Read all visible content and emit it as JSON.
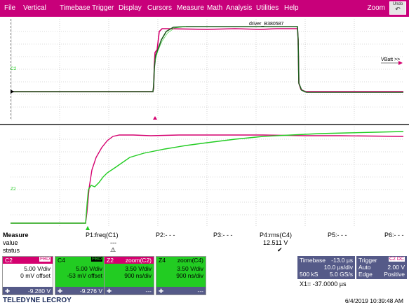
{
  "menu": {
    "items": [
      "File",
      "Vertical",
      "Timebase",
      "Trigger",
      "Display",
      "Cursors",
      "Measure",
      "Math",
      "Analysis",
      "Utilities",
      "Help"
    ],
    "zoom_label": "Zoom",
    "undo_label": "Undo"
  },
  "upper_grid": {
    "channel_label": "C2",
    "annotation": "driver_B380587",
    "vbatt_label": "VBatt >>"
  },
  "lower_grid": {
    "channel_label": "Z2"
  },
  "measure": {
    "header": "Measure",
    "row_labels": [
      "value",
      "status"
    ],
    "columns": [
      {
        "name": "P1:freq(C1)",
        "value": "---",
        "status": "warn"
      },
      {
        "name": "P2:- - -",
        "value": "",
        "status": ""
      },
      {
        "name": "P3:- - -",
        "value": "",
        "status": ""
      },
      {
        "name": "P4:rms(C4)",
        "value": "12.511 V",
        "status": "ok"
      },
      {
        "name": "P5:- - -",
        "value": "",
        "status": ""
      },
      {
        "name": "P6:- - -",
        "value": "",
        "status": ""
      }
    ]
  },
  "channels": [
    {
      "id": "C2",
      "tag": "FBD",
      "line1": "5.00 V/div",
      "line2": "0 mV offset",
      "footer": "-9.280 V",
      "color": "#d4006f"
    },
    {
      "id": "C4",
      "tag": "FBD",
      "line1": "5.00 V/div",
      "line2": "-53 mV offset",
      "footer": "-9.276 V",
      "color": "#22cc22"
    },
    {
      "id": "Z2",
      "tag": "zoom(C2)",
      "line1": "3.50 V/div",
      "line2": "900 ns/div",
      "footer": "---",
      "color": "#d4006f"
    },
    {
      "id": "Z4",
      "tag": "zoom(C4)",
      "line1": "3.50 V/div",
      "line2": "900 ns/div",
      "footer": "---",
      "color": "#22cc22"
    }
  ],
  "timebase": {
    "label": "Timebase",
    "delay": "-13.0 µs",
    "div": "10.0 µs/div",
    "samples": "500 kS",
    "rate": "5.0 GS/s",
    "cursor": "X1= -37.0000 µs"
  },
  "trigger": {
    "label": "Trigger",
    "tag": "C2 DC",
    "mode": "Auto",
    "level": "2.00 V",
    "type": "Edge",
    "slope": "Positive"
  },
  "brand": "TELEDYNE LECROY",
  "timestamp": "6/4/2019 10:39:48 AM",
  "colors": {
    "menu": "#c8007a",
    "c2": "#d4006f",
    "c4": "#22cc22",
    "zoom_bg": "#22cc22",
    "timebase_bg": "#555a88"
  }
}
